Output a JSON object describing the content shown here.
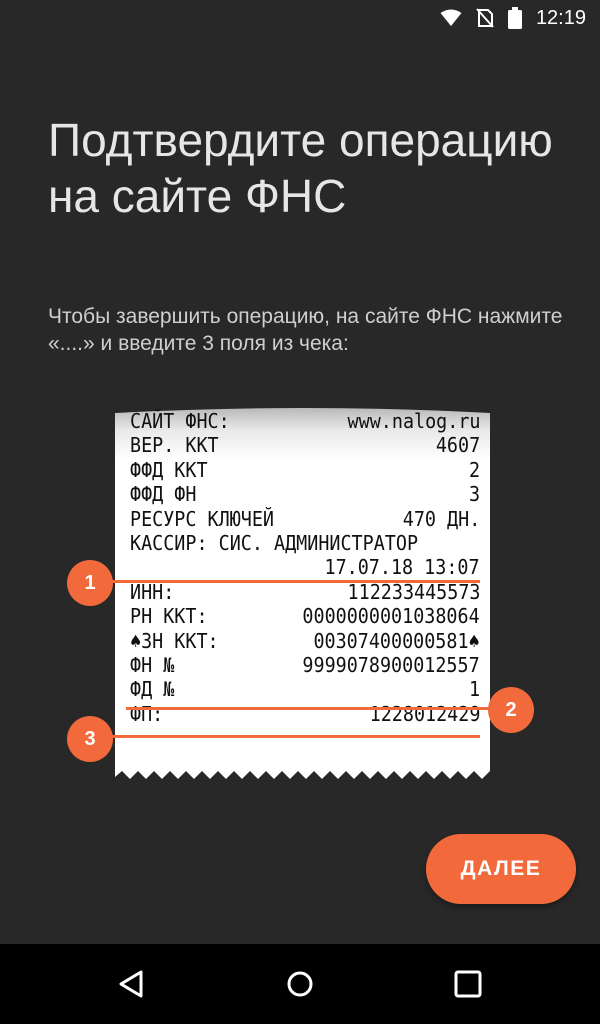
{
  "status_bar": {
    "time": "12:19",
    "icons": [
      "wifi-icon",
      "no-sim-icon",
      "battery-icon"
    ]
  },
  "title": "Подтвердите операцию на сайте ФНС",
  "subtitle": "Чтобы завершить операцию, на сайте ФНС нажмите «....» и введите 3 поля из чека:",
  "receipt": {
    "lines": [
      {
        "label": "САЙТ ФНС:",
        "value": "www.nalog.ru"
      },
      {
        "label": "ВЕР. ККТ",
        "value": "4607"
      },
      {
        "label": "ФФД ККТ",
        "value": "2"
      },
      {
        "label": "ФФД ФН",
        "value": "3"
      },
      {
        "label": "РЕСУРС КЛЮЧЕЙ",
        "value": "470 ДН."
      },
      {
        "label": "КАССИР: СИС. АДМИНИСТРАТОР",
        "value": ""
      },
      {
        "label": "",
        "value": "17.07.18 13:07"
      },
      {
        "label": "ИНН:",
        "value": "112233445573"
      },
      {
        "label": "РН ККТ:",
        "value": "0000000001038064"
      },
      {
        "label": "♠ЗН ККТ:",
        "value": "00307400000581♠"
      },
      {
        "label": "ФН №",
        "value": "9999078900012557"
      },
      {
        "label": "ФД №",
        "value": "1"
      },
      {
        "label": "ФП:",
        "value": "1228012429"
      }
    ]
  },
  "markers": [
    "1",
    "2",
    "3"
  ],
  "accent_color": "#f26a3c",
  "next_button": {
    "label": "ДАЛЕЕ"
  },
  "nav": {
    "icons": [
      "back-icon",
      "home-icon",
      "recents-icon"
    ]
  }
}
